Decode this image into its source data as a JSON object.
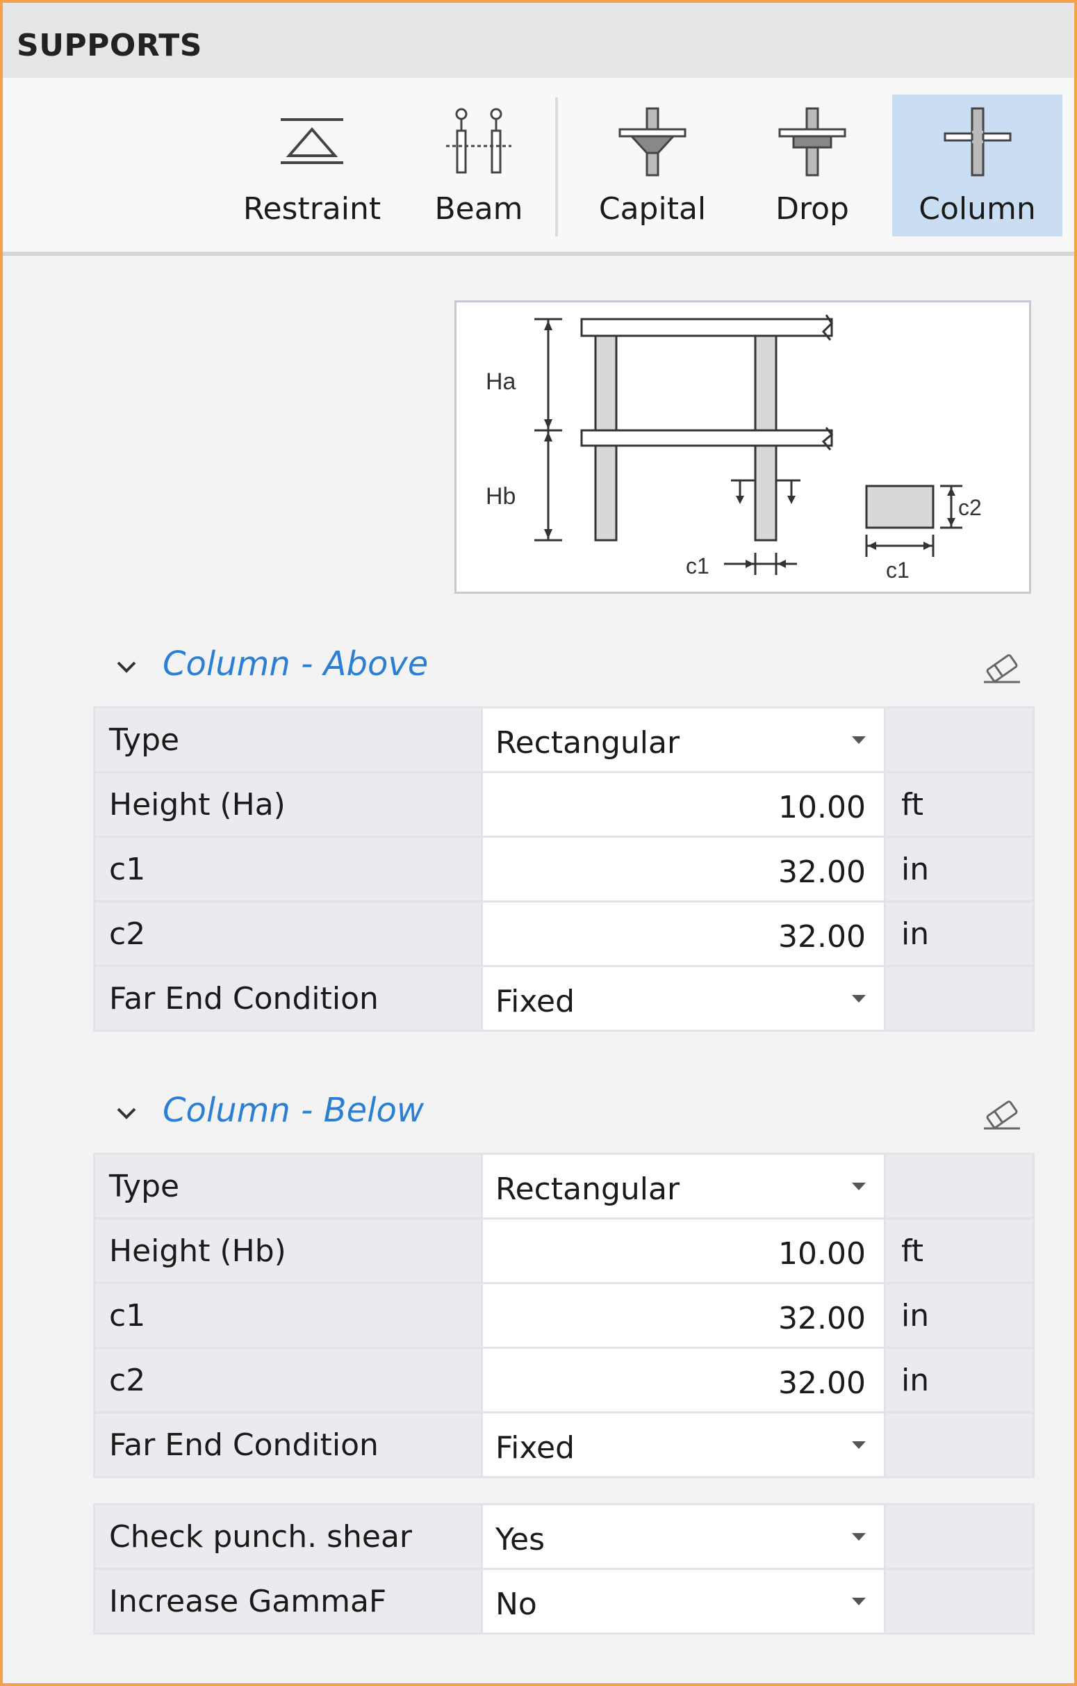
{
  "panel": {
    "title": "SUPPORTS"
  },
  "toolbar": {
    "restraint_label": "Restraint",
    "beam_label": "Beam",
    "capital_label": "Capital",
    "drop_label": "Drop",
    "column_label": "Column",
    "active": "Column"
  },
  "diagram": {
    "label_ha": "Ha",
    "label_hb": "Hb",
    "label_c1_bottom": "c1",
    "label_c1_section": "c1",
    "label_c2_section": "c2"
  },
  "column_above": {
    "title": "Column - Above",
    "rows": [
      {
        "label": "Type",
        "value": "Rectangular",
        "unit": ""
      },
      {
        "label": "Height (Ha)",
        "value": "10.00",
        "unit": "ft"
      },
      {
        "label": "c1",
        "value": "32.00",
        "unit": "in"
      },
      {
        "label": "c2",
        "value": "32.00",
        "unit": "in"
      },
      {
        "label": "Far End Condition",
        "value": "Fixed",
        "unit": ""
      }
    ]
  },
  "column_below": {
    "title": "Column - Below",
    "rows": [
      {
        "label": "Type",
        "value": "Rectangular",
        "unit": ""
      },
      {
        "label": "Height (Hb)",
        "value": "10.00",
        "unit": "ft"
      },
      {
        "label": "c1",
        "value": "32.00",
        "unit": "in"
      },
      {
        "label": "c2",
        "value": "32.00",
        "unit": "in"
      },
      {
        "label": "Far End Condition",
        "value": "Fixed",
        "unit": ""
      }
    ]
  },
  "options": {
    "rows": [
      {
        "label": "Check punch. shear",
        "value": "Yes"
      },
      {
        "label": "Increase GammaF",
        "value": "No"
      }
    ]
  },
  "icons": {
    "restraint": "restraint-icon",
    "beam": "beam-icon",
    "capital": "capital-icon",
    "drop": "drop-icon",
    "column": "column-icon",
    "expand": "chevron-down-icon",
    "clear": "eraser-icon",
    "dropdown": "caret-down-icon"
  },
  "colors": {
    "border": "#f5a04a",
    "active_tool": "#c9def3",
    "section_title": "#2a7fd4"
  }
}
